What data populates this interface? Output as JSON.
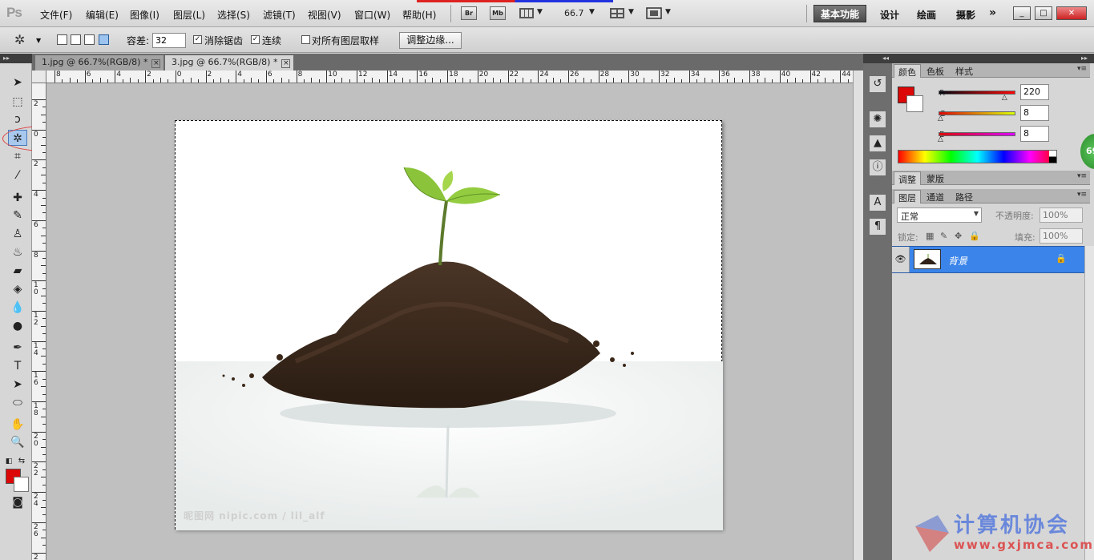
{
  "app": {
    "logo": "Ps"
  },
  "menubar": {
    "items": [
      "文件(F)",
      "编辑(E)",
      "图像(I)",
      "图层(L)",
      "选择(S)",
      "滤镜(T)",
      "视图(V)",
      "窗口(W)",
      "帮助(H)"
    ],
    "bridge_label": "Br",
    "minibridge_label": "Mb",
    "zoom_level": "66.7",
    "workspaces": [
      "基本功能",
      "设计",
      "绘画",
      "摄影"
    ],
    "more_workspaces": "»",
    "window_buttons": [
      "_",
      "□",
      "✕"
    ]
  },
  "options": {
    "tolerance_label": "容差:",
    "tolerance_value": "32",
    "antialias_label": "消除锯齿",
    "antialias_checked": true,
    "contiguous_label": "连续",
    "contiguous_checked": true,
    "sample_all_label": "对所有图层取样",
    "sample_all_checked": false,
    "refine_edge_label": "调整边缘..."
  },
  "doc_tabs": [
    {
      "label": "1.jpg @ 66.7%(RGB/8) *",
      "active": false
    },
    {
      "label": "3.jpg @ 66.7%(RGB/8) *",
      "active": true
    }
  ],
  "rulers": {
    "h_labels": [
      "8",
      "6",
      "4",
      "2",
      "0",
      "2",
      "4",
      "6",
      "8",
      "10",
      "12",
      "14",
      "16",
      "18",
      "20",
      "22",
      "24",
      "26",
      "28",
      "30",
      "32",
      "34",
      "36",
      "38",
      "40",
      "42",
      "44"
    ],
    "v_labels": [
      "2",
      "0",
      "2",
      "4",
      "6",
      "8",
      "1 0",
      "1 2",
      "1 4",
      "1 6",
      "1 8",
      "2 0",
      "2 2",
      "2 4",
      "2 6",
      "2 8"
    ]
  },
  "image": {
    "watermark": "昵图网 nipic.com / lil_alf"
  },
  "color_panel": {
    "tabs": [
      "颜色",
      "色板",
      "样式"
    ],
    "r_label": "R",
    "g_label": "G",
    "b_label": "B",
    "r": 220,
    "g": 8,
    "b": 8,
    "foreground_color": "#dc0808",
    "background_color": "#ffffff"
  },
  "adjust_panel": {
    "tabs": [
      "调整",
      "蒙版"
    ]
  },
  "layers_panel": {
    "tabs": [
      "图层",
      "通道",
      "路径"
    ],
    "blend_mode": "正常",
    "opacity_label": "不透明度:",
    "opacity_value": "100%",
    "lock_label": "锁定:",
    "fill_label": "填充:",
    "fill_value": "100%",
    "layers": [
      {
        "name": "背景",
        "locked": true,
        "visible": true
      }
    ]
  },
  "zoom_bubble": "69",
  "site_watermark": {
    "title": "计算机协会",
    "url": "www.gxjmca.com"
  }
}
